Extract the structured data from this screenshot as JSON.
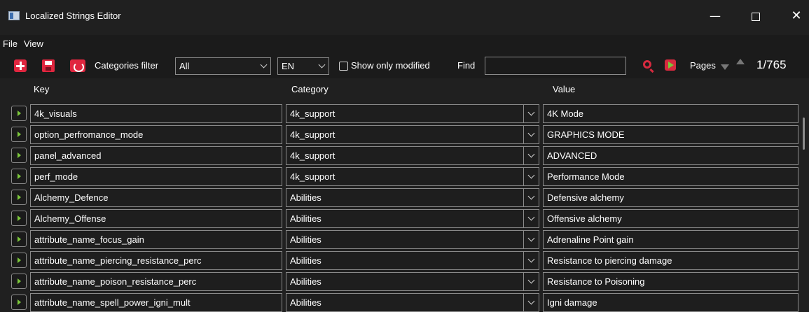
{
  "window": {
    "title": "Localized Strings Editor",
    "minimize": "—",
    "maximize": "",
    "close": "✕"
  },
  "menu": {
    "items": [
      "File",
      "View"
    ]
  },
  "toolbar": {
    "categories_filter_label": "Categories filter",
    "category_filter_value": "All",
    "language_value": "EN",
    "show_only_modified_label": "Show only modified",
    "show_only_modified_checked": false,
    "find_label": "Find",
    "find_value": "",
    "pages_label": "Pages",
    "page_counter": "1/765"
  },
  "icons": {
    "add": "add-icon",
    "save": "save-icon",
    "revert": "revert-icon",
    "search": "search-icon",
    "find_next": "find-next-icon"
  },
  "colors": {
    "accent_red": "#e0263f",
    "accent_green": "#7bc63a",
    "background": "#202020"
  },
  "table": {
    "columns": {
      "key": "Key",
      "category": "Category",
      "value": "Value"
    },
    "rows": [
      {
        "key": "4k_visuals",
        "category": "4k_support",
        "value": "4K Mode"
      },
      {
        "key": "option_perfromance_mode",
        "category": "4k_support",
        "value": "GRAPHICS MODE"
      },
      {
        "key": "panel_advanced",
        "category": "4k_support",
        "value": "ADVANCED"
      },
      {
        "key": "perf_mode",
        "category": "4k_support",
        "value": "Performance Mode"
      },
      {
        "key": "Alchemy_Defence",
        "category": "Abilities",
        "value": "Defensive alchemy"
      },
      {
        "key": "Alchemy_Offense",
        "category": "Abilities",
        "value": "Offensive alchemy"
      },
      {
        "key": "attribute_name_focus_gain",
        "category": "Abilities",
        "value": "Adrenaline Point gain"
      },
      {
        "key": "attribute_name_piercing_resistance_perc",
        "category": "Abilities",
        "value": "Resistance to piercing damage"
      },
      {
        "key": "attribute_name_poison_resistance_perc",
        "category": "Abilities",
        "value": "Resistance to Poisoning"
      },
      {
        "key": "attribute_name_spell_power_igni_mult",
        "category": "Abilities",
        "value": "Igni damage"
      }
    ]
  }
}
